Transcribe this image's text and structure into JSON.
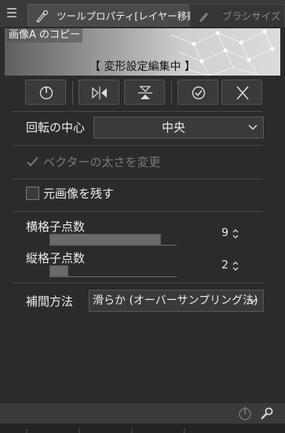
{
  "tabs": [
    {
      "label": "ツールプロパティ[レイヤー移動]",
      "icon": "brush-settings-icon",
      "active": true
    },
    {
      "label": "ブラシサイズ",
      "icon": "brush-size-icon",
      "active": false
    }
  ],
  "preview": {
    "layer_name": "画像A のコピー",
    "mode_text": "【 変形設定編集中 】"
  },
  "actions": [
    {
      "name": "rotate-button",
      "icon": "rotate-dial-icon"
    },
    {
      "name": "flip-horizontal-button",
      "icon": "flip-horizontal-icon"
    },
    {
      "name": "flip-vertical-button",
      "icon": "flip-vertical-icon"
    },
    {
      "name": "confirm-button",
      "icon": "check-circle-icon"
    },
    {
      "name": "cancel-button",
      "icon": "close-icon"
    }
  ],
  "rotation_center": {
    "label": "回転の中心",
    "value": "中央"
  },
  "vector_thickness": {
    "label": "ベクターの太さを変更",
    "checked": true,
    "enabled": false
  },
  "keep_original": {
    "label": "元画像を残す",
    "checked": false
  },
  "horizontal_grid": {
    "label": "横格子点数",
    "value": "9"
  },
  "vertical_grid": {
    "label": "縦格子点数",
    "value": "2"
  },
  "interpolation": {
    "label": "補間方法",
    "value": "滑らか (オーバーサンプリング法)"
  },
  "colors": {
    "accent": "#e6e6e6",
    "panel": "#2b2b2b",
    "control": "#3a3a3a"
  }
}
